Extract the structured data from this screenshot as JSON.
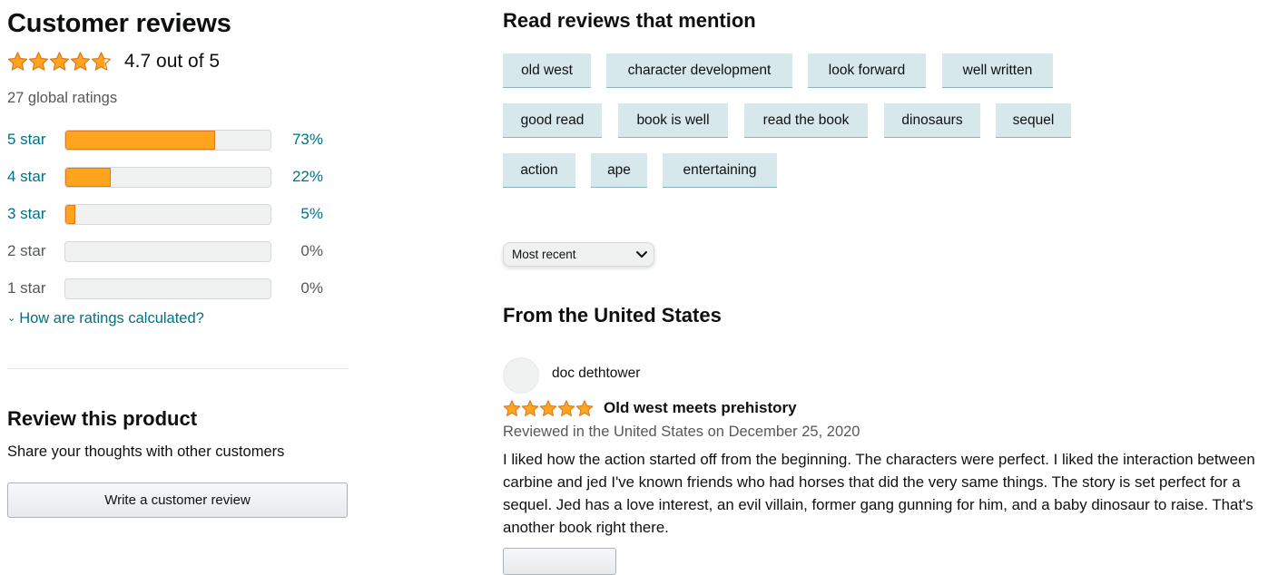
{
  "summary": {
    "title": "Customer reviews",
    "average_text": "4.7 out of 5",
    "average_rating": 4.7,
    "global_ratings": "27 global ratings",
    "accent_color": "#ffa41c",
    "histogram": [
      {
        "label": "5 star",
        "percent_text": "73%",
        "percent": 73
      },
      {
        "label": "4 star",
        "percent_text": "22%",
        "percent": 22
      },
      {
        "label": "3 star",
        "percent_text": "5%",
        "percent": 5
      },
      {
        "label": "2 star",
        "percent_text": "0%",
        "percent": 0
      },
      {
        "label": "1 star",
        "percent_text": "0%",
        "percent": 0
      }
    ],
    "how_calculated": "How are ratings calculated?"
  },
  "review_product": {
    "title": "Review this product",
    "subtitle": "Share your thoughts with other customers",
    "button_label": "Write a customer review"
  },
  "mentions": {
    "title": "Read reviews that mention",
    "chips": [
      "old west",
      "character development",
      "look forward",
      "well written",
      "good read",
      "book is well",
      "read the book",
      "dinosaurs",
      "sequel",
      "action",
      "ape",
      "entertaining"
    ]
  },
  "sort": {
    "selected": "Most recent"
  },
  "reviews_section": {
    "title": "From the United States"
  },
  "review": {
    "author": "doc dethtower",
    "rating": 5,
    "title": "Old west meets prehistory",
    "date_text": "Reviewed in the United States on December 25, 2020",
    "body": "I liked how the action started off from the beginning. The characters were perfect. I liked the interaction between carbine and jed I've known friends who had horses that did the very same things. The story is set perfect for a sequel. Jed has a love interest, an evil villain, former gang gunning for him, and a baby dinosaur to raise. That's another book right there."
  }
}
